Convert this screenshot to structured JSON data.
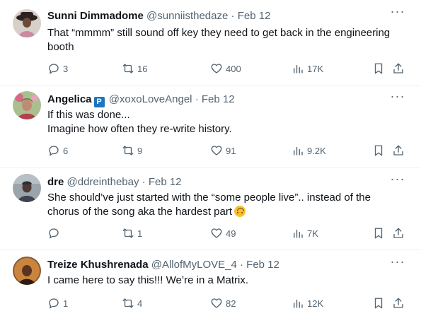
{
  "tweets": [
    {
      "name": "Sunni Dimmadome",
      "handle": "@sunniisthedaze",
      "separator": "·",
      "date": "Feb 12",
      "verified": false,
      "lines": [
        "That “mmmm” still sound off key they need to get back in the engineering",
        "booth"
      ],
      "replies": "3",
      "retweets": "16",
      "likes": "400",
      "views": "17K",
      "avatar_colors": {
        "bg": "#d7cfc8",
        "skin": "#6a4a3a",
        "hat": "#2b2222",
        "shirt": "#c98aa0"
      }
    },
    {
      "name": "Angelica",
      "badge": "P",
      "handle": "@xoxoLoveAngel",
      "separator": "·",
      "date": "Feb 12",
      "verified": true,
      "lines": [
        "If this was done...",
        "Imagine how often they re-write history."
      ],
      "replies": "6",
      "retweets": "9",
      "likes": "91",
      "views": "9.2K",
      "avatar_colors": {
        "bg": "#a9bf8f",
        "skin": "#c08a73",
        "hat": "#6b7a4a",
        "shirt": "#b3404a"
      }
    },
    {
      "name": "dre",
      "handle": "@ddreinthebay",
      "separator": "·",
      "date": "Feb 12",
      "verified": false,
      "lines": [
        "She should’ve just started with the “some people live”.. instead of the",
        "chorus of the song aka the hardest part"
      ],
      "has_emoji": true,
      "emoji_name": "upside-down-face-emoji",
      "replies": "",
      "retweets": "1",
      "likes": "49",
      "views": "7K",
      "avatar_colors": {
        "bg": "#9aa4aa",
        "skin": "#4d3a33",
        "hat": "#2a2f36",
        "shirt": "#3b4450"
      }
    },
    {
      "name": "Treize Khushrenada",
      "handle": "@AllofMyLOVE_4",
      "separator": "·",
      "date": "Feb 12",
      "verified": false,
      "lines": [
        "I came here to say this!!! We’re in a Matrix."
      ],
      "replies": "1",
      "retweets": "4",
      "likes": "82",
      "views": "12K",
      "avatar_colors": {
        "bg": "#8a5a35",
        "skin": "#5a3420",
        "hat": "#c9853d",
        "shirt": "#2e1c12"
      }
    }
  ],
  "icons": {
    "more": "more-icon",
    "reply": "reply-icon",
    "retweet": "retweet-icon",
    "like": "heart-icon",
    "views": "views-icon",
    "bookmark": "bookmark-icon",
    "share": "share-icon"
  },
  "colors": {
    "text": "#0f1419",
    "secondary": "#536471",
    "divider": "#eff3f4",
    "badge": "#1d75bd"
  }
}
